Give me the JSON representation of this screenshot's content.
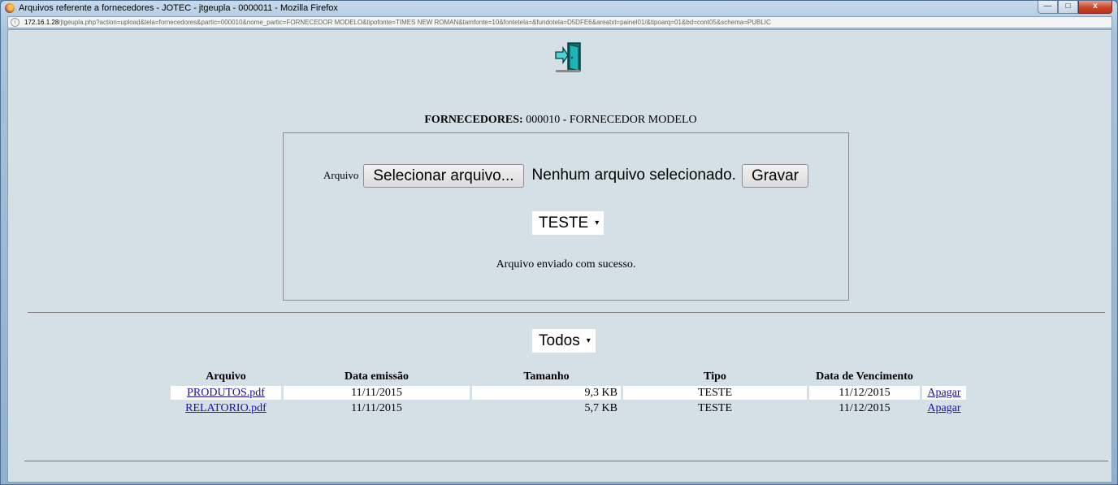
{
  "window": {
    "title": "Arquivos referente a fornecedores - JOTEC - jtgeupla - 0000011 - Mozilla Firefox",
    "controls": {
      "minimize": "—",
      "maximize": "□",
      "close": "x"
    }
  },
  "urlbar": {
    "host": "172.16.1.28",
    "path": "/jtgeupla.php?action=upload&tela=fornecedores&partic=000010&nome_partic=FORNECEDOR MODELO&tipofonte=TIMES NEW ROMAN&tamfonte=10&fontetela=&fundotela=D5DFE6&areatxt=painel01/&tipoarq=01&bd=cont05&schema=PUBLIC"
  },
  "header": {
    "entity_label": "FORNECEDORES:",
    "entity_value": "000010 - FORNECEDOR MODELO"
  },
  "upload": {
    "field_label": "Arquivo",
    "select_file_button": "Selecionar arquivo...",
    "no_file_text": "Nenhum arquivo selecionado.",
    "save_button": "Gravar",
    "type_select": "TESTE",
    "status_message": "Arquivo enviado com sucesso."
  },
  "filter": {
    "selected": "Todos"
  },
  "table": {
    "columns": [
      "Arquivo",
      "Data emissão",
      "Tamanho",
      "Tipo",
      "Data de Vencimento"
    ],
    "rows": [
      {
        "arquivo": "PRODUTOS.pdf",
        "data_emissao": "11/11/2015",
        "tamanho": "9,3 KB",
        "tipo": "TESTE",
        "data_vencimento": "11/12/2015",
        "acao": "Apagar"
      },
      {
        "arquivo": "RELATORIO.pdf",
        "data_emissao": "11/11/2015",
        "tamanho": "5,7 KB",
        "tipo": "TESTE",
        "data_vencimento": "11/12/2015",
        "acao": "Apagar"
      }
    ]
  },
  "colors": {
    "page_background": "#D5DFE6",
    "link": "#1a0dab",
    "close_button": "#c9462d"
  }
}
